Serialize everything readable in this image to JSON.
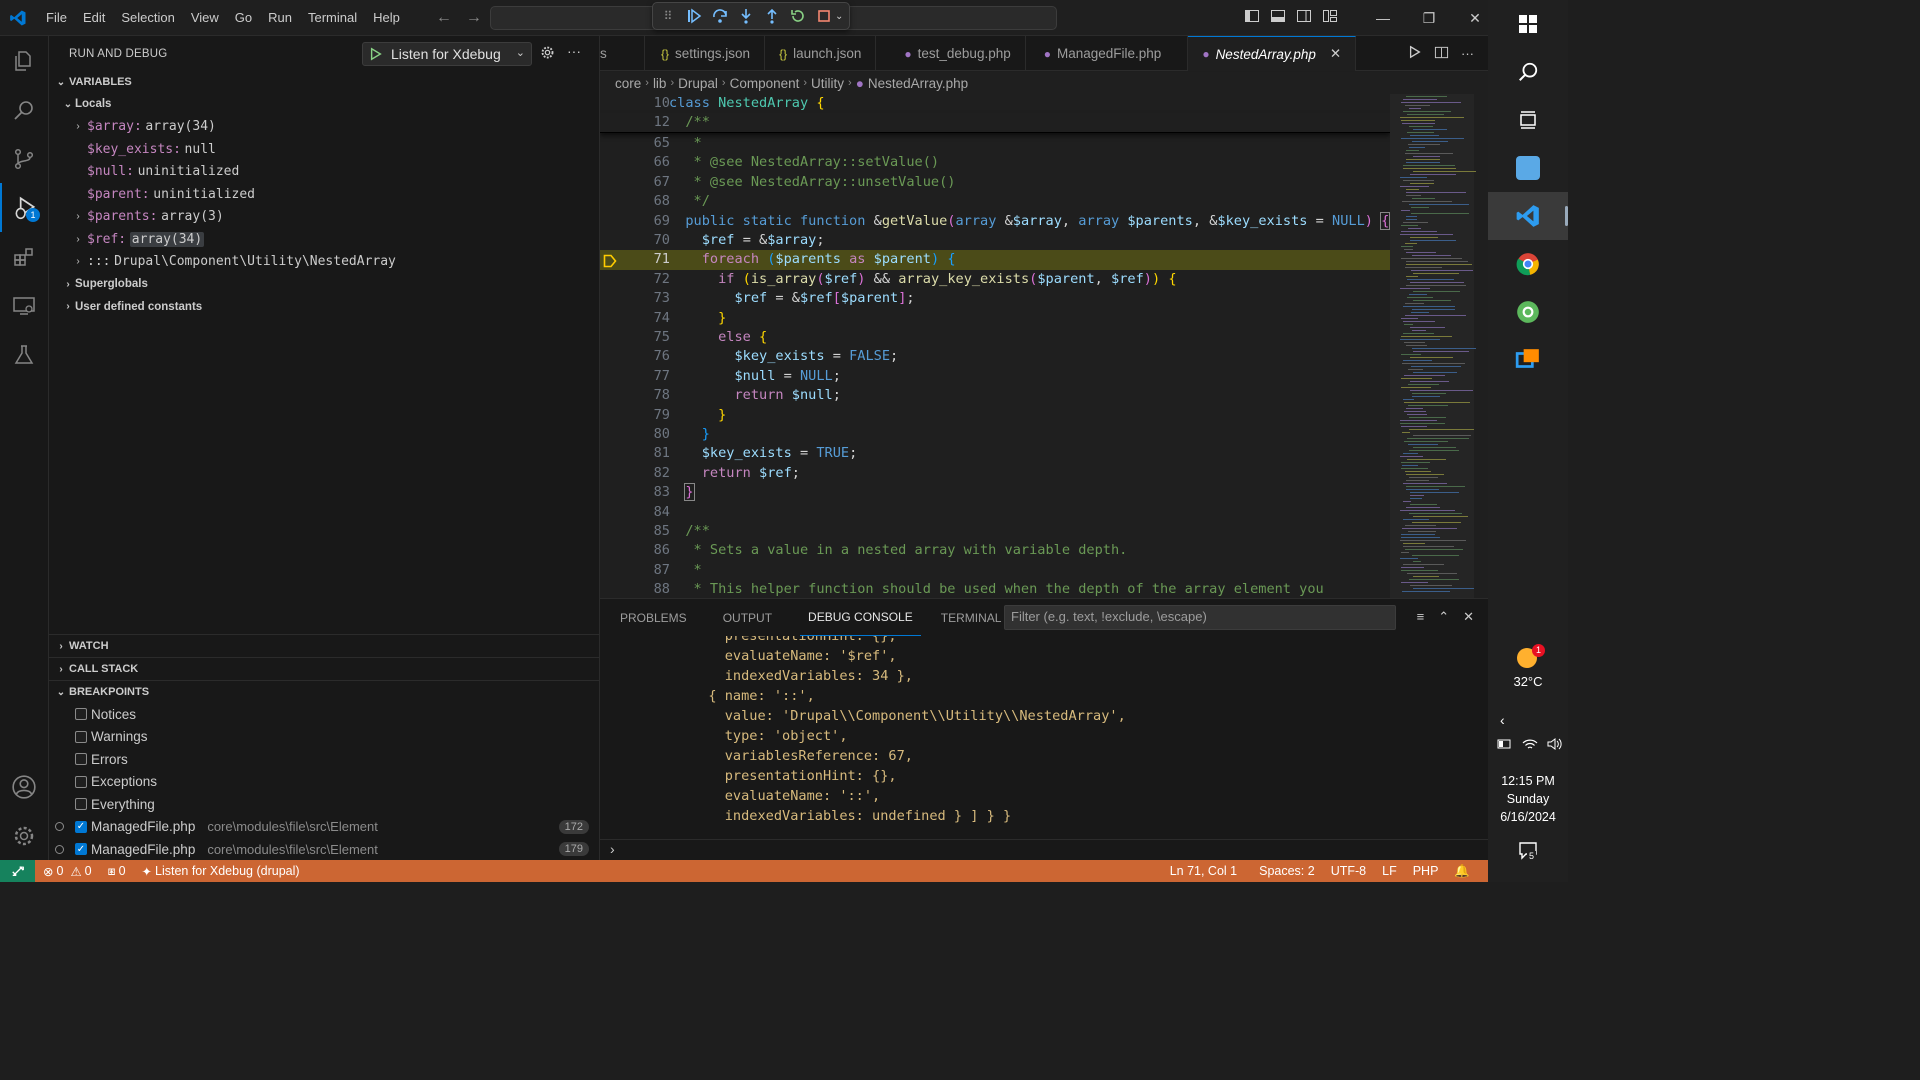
{
  "menu": [
    "File",
    "Edit",
    "Selection",
    "View",
    "Go",
    "Run",
    "Terminal",
    "Help"
  ],
  "colors": {
    "accent": "#0078d4",
    "statusbar": "#cc6633",
    "current_line": "#4b4b18"
  },
  "sidebar": {
    "title": "RUN AND DEBUG",
    "launch_config": "Listen for Xdebug",
    "badge": "1",
    "variables": {
      "header": "VARIABLES",
      "locals_label": "Locals",
      "items": [
        {
          "name": "$array:",
          "value": "array(34)",
          "expandable": true
        },
        {
          "name": "$key_exists:",
          "value": "null",
          "expandable": false
        },
        {
          "name": "$null:",
          "value": "uninitialized",
          "expandable": false
        },
        {
          "name": "$parent:",
          "value": "uninitialized",
          "expandable": false
        },
        {
          "name": "$parents:",
          "value": "array(3)",
          "expandable": true
        },
        {
          "name": "$ref:",
          "value": "array(34)",
          "expandable": true
        },
        {
          "name": ":::",
          "value": "Drupal\\Component\\Utility\\NestedArray",
          "expandable": true
        }
      ],
      "superglobals": "Superglobals",
      "constants": "User defined constants"
    },
    "watch": "WATCH",
    "call_stack": "CALL STACK",
    "breakpoints": {
      "header": "BREAKPOINTS",
      "exceptions": [
        {
          "label": "Notices",
          "checked": false
        },
        {
          "label": "Warnings",
          "checked": false
        },
        {
          "label": "Errors",
          "checked": false
        },
        {
          "label": "Exceptions",
          "checked": false
        },
        {
          "label": "Everything",
          "checked": false
        }
      ],
      "files": [
        {
          "file": "ManagedFile.php",
          "path": "core\\modules\\file\\src\\Element",
          "line": "172"
        },
        {
          "file": "ManagedFile.php",
          "path": "core\\modules\\file\\src\\Element",
          "line": "179"
        }
      ]
    }
  },
  "tabs": [
    {
      "label": "s",
      "icon": ""
    },
    {
      "label": "settings.json",
      "icon": "{}"
    },
    {
      "label": "launch.json",
      "icon": "{}"
    },
    {
      "label": "test_debug.php",
      "icon": "php-icon"
    },
    {
      "label": "ManagedFile.php",
      "icon": "php-icon"
    },
    {
      "label": "NestedArray.php",
      "icon": "php-icon",
      "active": true
    }
  ],
  "breadcrumb": [
    "core",
    "lib",
    "Drupal",
    "Component",
    "Utility",
    "NestedArray.php"
  ],
  "editor": {
    "current_line": "71",
    "line_numbers": [
      "10",
      "12",
      "65",
      "66",
      "67",
      "68",
      "69",
      "70",
      "71",
      "72",
      "73",
      "74",
      "75",
      "76",
      "77",
      "78",
      "79",
      "80",
      "81",
      "82",
      "83",
      "84",
      "85",
      "86",
      "87",
      "88"
    ]
  },
  "panel": {
    "tabs": [
      "PROBLEMS",
      "OUTPUT",
      "DEBUG CONSOLE",
      "TERMINAL",
      "PORTS"
    ],
    "active_tab": "DEBUG CONSOLE",
    "filter_placeholder": "Filter (e.g. text, !exclude, \\escape)",
    "console_lines": [
      "    presentationHint: {},",
      "    evaluateName: '$ref',",
      "    indexedVariables: 34 },",
      "  { name: '::',",
      "    value: 'Drupal\\\\Component\\\\Utility\\\\NestedArray',",
      "    type: 'object',",
      "    variablesReference: 67,",
      "    presentationHint: {},",
      "    evaluateName: '::',",
      "    indexedVariables: undefined } ] } }"
    ]
  },
  "statusbar": {
    "errors": "0",
    "warnings": "0",
    "ports": "0",
    "debug_session": "Listen for Xdebug (drupal)",
    "position": "Ln 71, Col 1",
    "spaces": "Spaces: 2",
    "encoding": "UTF-8",
    "eol": "LF",
    "language": "PHP"
  },
  "taskbar": {
    "temperature": "32°C",
    "weather_badge": "1",
    "time": "12:15 PM",
    "day": "Sunday",
    "date": "6/16/2024",
    "notifications": "5"
  }
}
